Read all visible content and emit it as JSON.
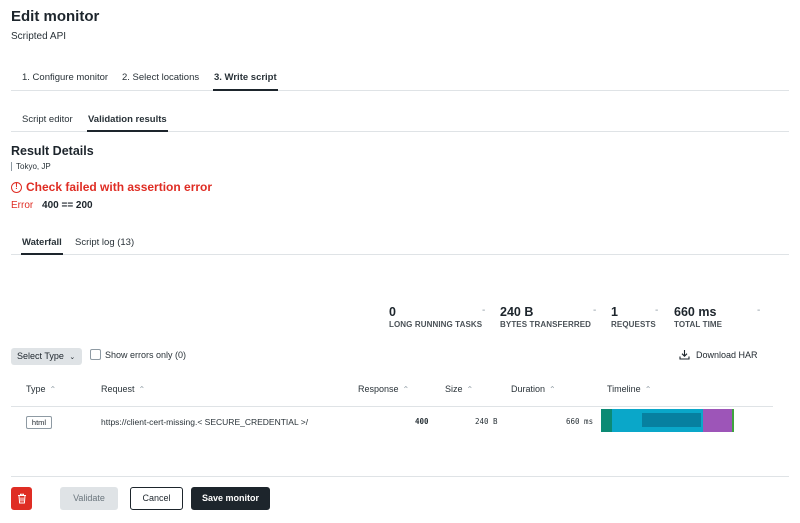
{
  "header": {
    "title": "Edit monitor",
    "subtitle": "Scripted API"
  },
  "main_tabs": [
    {
      "label": "1. Configure monitor",
      "active": false
    },
    {
      "label": "2. Select locations",
      "active": false
    },
    {
      "label": "3. Write script",
      "active": true
    }
  ],
  "sub_tabs": [
    {
      "label": "Script editor",
      "active": false
    },
    {
      "label": "Validation results",
      "active": true
    }
  ],
  "result": {
    "title": "Result Details",
    "location": "Tokyo, JP",
    "fail_message": "Check failed with assertion error",
    "error_label": "Error",
    "error_value": "400 == 200"
  },
  "result_tabs": [
    {
      "label": "Waterfall",
      "active": true
    },
    {
      "label": "Script log (13)",
      "active": false
    }
  ],
  "stats": [
    {
      "value": "0",
      "label": "LONG RUNNING TASKS"
    },
    {
      "value": "240 B",
      "label": "BYTES TRANSFERRED"
    },
    {
      "value": "1",
      "label": "REQUESTS"
    },
    {
      "value": "660 ms",
      "label": "TOTAL TIME"
    }
  ],
  "stat_separator": "-",
  "filters": {
    "select_type_label": "Select Type",
    "show_errors_label": "Show errors only (0)",
    "show_errors_checked": false,
    "download_har_label": "Download HAR"
  },
  "table": {
    "columns": [
      "Type",
      "Request",
      "Response",
      "Size",
      "Duration",
      "Timeline"
    ],
    "sort_glyph": "⌃",
    "rows": [
      {
        "type": "html",
        "request": "https://client-cert-missing.< SECURE_CREDENTIAL >/",
        "response": "400",
        "size": "240 B",
        "duration": "660 ms"
      }
    ]
  },
  "timeline_colors": {
    "segment_1": "#0b8a74",
    "segment_2": "#0aa7c9",
    "segment_3": "#0780a0",
    "segment_4": "#9d55b8",
    "segment_5": "#3fa33f"
  },
  "footer": {
    "validate_label": "Validate",
    "cancel_label": "Cancel",
    "save_label": "Save monitor"
  },
  "colors": {
    "error": "#df2d24",
    "primary_button": "#1d252c",
    "divider": "#dfe3e6"
  }
}
